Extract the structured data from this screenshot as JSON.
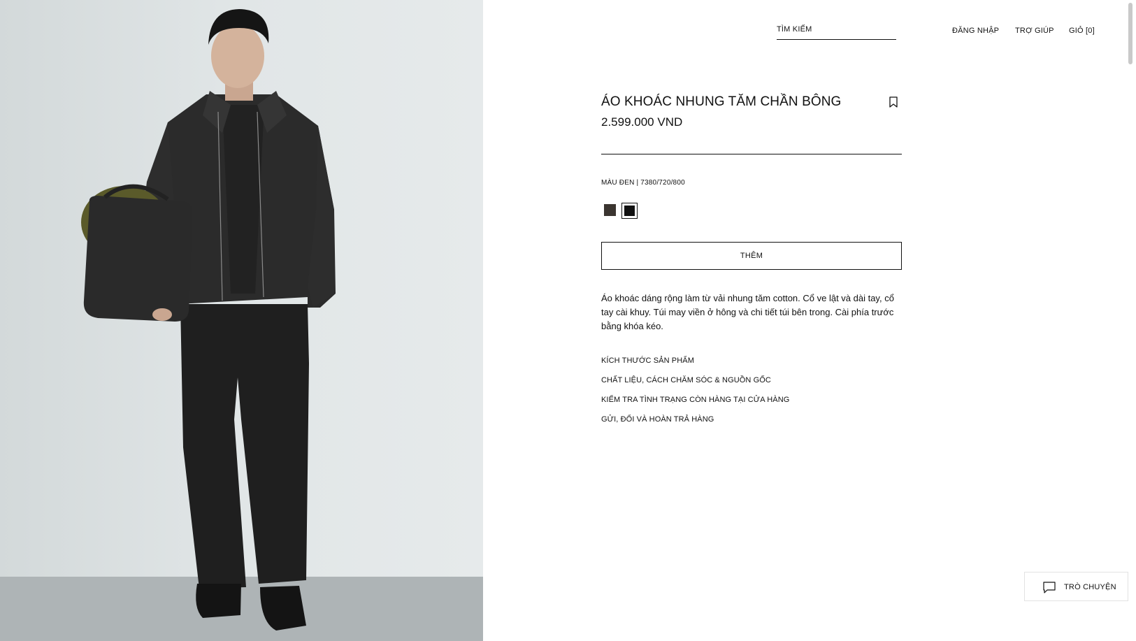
{
  "header": {
    "search_label": "TÌM KIẾM",
    "login": "ĐĂNG NHẬP",
    "help": "TRỢ GIÚP",
    "cart": "GIỎ [0]"
  },
  "product": {
    "title": "ÁO KHOÁC NHUNG TĂM CHẦN BÔNG",
    "price": "2.599.000 VND",
    "color_line": "MÀU ĐEN | 7380/720/800",
    "swatches": [
      {
        "name": "brown",
        "color": "#3b3530",
        "selected": false
      },
      {
        "name": "black",
        "color": "#111111",
        "selected": true
      }
    ],
    "add_button": "THÊM",
    "description": "Áo khoác dáng rộng làm từ vải nhung tăm cotton. Cổ ve lật và dài tay, cổ tay cài khuy. Túi may viền ở hông và chi tiết túi bên trong. Cài phía trước bằng khóa kéo.",
    "links": [
      "KÍCH THƯỚC SẢN PHẨM",
      "CHẤT LIỆU, CÁCH CHĂM SÓC & NGUỒN GỐC",
      "KIỂM TRA TÌNH TRẠNG CÒN HÀNG TẠI CỬA HÀNG",
      "GỬI, ĐỔI VÀ HOÀN TRẢ HÀNG"
    ]
  },
  "chat": {
    "label": "TRÒ CHUYỆN",
    "icon": "chat-bubble-icon"
  },
  "icons": {
    "bookmark": "bookmark-icon"
  },
  "colors": {
    "text": "#111111",
    "background": "#ffffff",
    "photo_wall": "#dfe4e5",
    "photo_floor": "#aeb4b6"
  }
}
